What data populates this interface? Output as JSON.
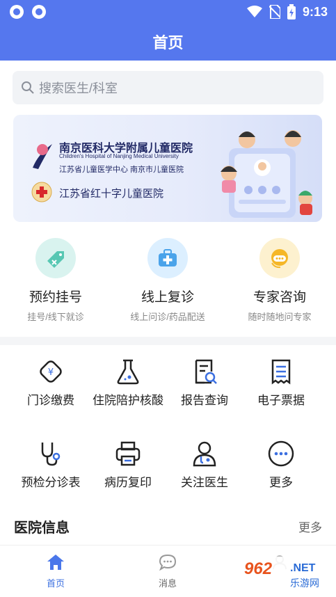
{
  "status_bar": {
    "time": "9:13"
  },
  "header": {
    "title": "首页"
  },
  "search": {
    "placeholder": "搜索医生/科室"
  },
  "banner": {
    "hospital_cn": "南京医科大学附属儿童医院",
    "hospital_en": "Children's Hospital of Nanjing Medical University",
    "subtitle": "江苏省儿童医学中心    南京市儿童医院",
    "red_cross_name": "江苏省红十字儿童医院"
  },
  "services": [
    {
      "title": "预约挂号",
      "subtitle": "挂号/线下就诊",
      "color": "#d9f3ef",
      "icon": "tag-icon"
    },
    {
      "title": "线上复诊",
      "subtitle": "线上问诊/药品配送",
      "color": "#dcefff",
      "icon": "medkit-icon"
    },
    {
      "title": "专家咨询",
      "subtitle": "随时随地问专家",
      "color": "#fdf1cf",
      "icon": "headset-icon"
    }
  ],
  "grid": [
    {
      "label": "门诊缴费",
      "icon": "payment-icon"
    },
    {
      "label": "住院陪护核酸",
      "icon": "flask-icon"
    },
    {
      "label": "报告查询",
      "icon": "report-search-icon"
    },
    {
      "label": "电子票据",
      "icon": "receipt-icon"
    },
    {
      "label": "预检分诊表",
      "icon": "stethoscope-icon"
    },
    {
      "label": "病历复印",
      "icon": "printer-icon"
    },
    {
      "label": "关注医生",
      "icon": "doctor-icon"
    },
    {
      "label": "更多",
      "icon": "more-icon"
    }
  ],
  "hospital_info": {
    "title": "医院信息",
    "more": "更多"
  },
  "tabbar": [
    {
      "label": "首页",
      "active": true
    },
    {
      "label": "消息",
      "active": false
    }
  ],
  "watermark": {
    "brand": "962",
    "domain": ".NET",
    "cn": "乐游网"
  },
  "colors": {
    "primary": "#5577ee",
    "accent": "#3b6fe0",
    "text": "#222222"
  }
}
